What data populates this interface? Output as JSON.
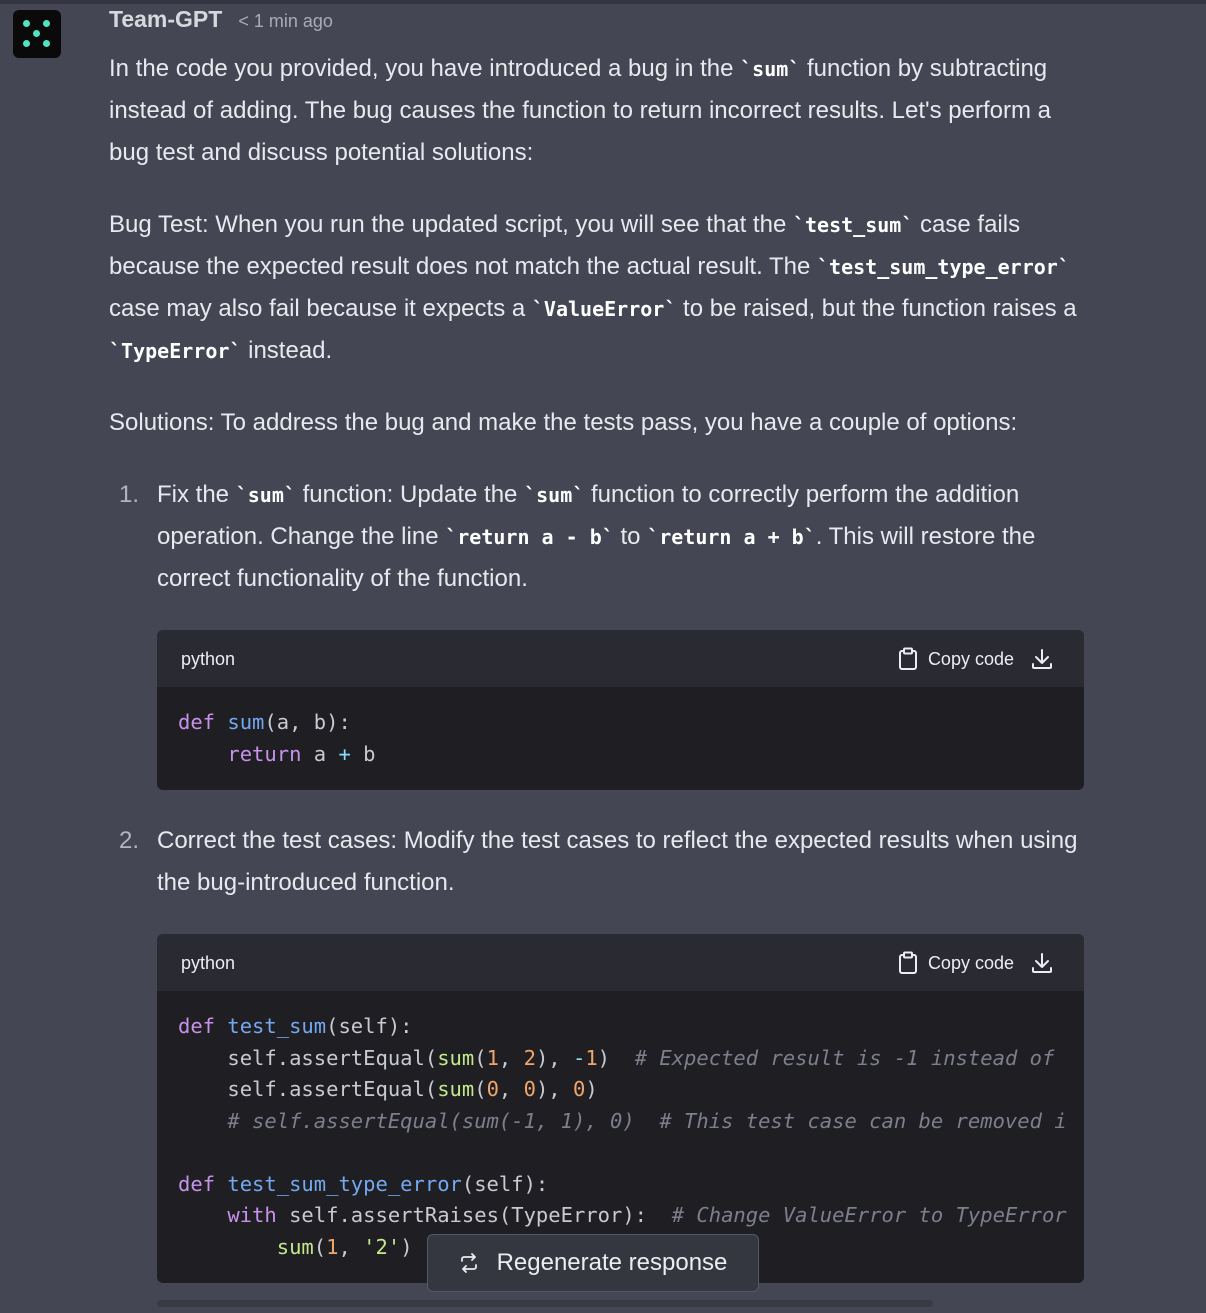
{
  "message": {
    "sender": "Team-GPT",
    "timestamp": "< 1 min ago",
    "para1": {
      "t1": "In the code you provided, you have introduced a bug in the ",
      "c1": "`sum`",
      "t2": " function by subtracting instead of adding. The bug causes the function to return incorrect results. Let's perform a bug test and discuss potential solutions:"
    },
    "para2": {
      "t1": "Bug Test: When you run the updated script, you will see that the ",
      "c1": "`test_sum`",
      "t2": " case fails because the expected result does not match the actual result. The ",
      "c2": "`test_sum_type_error`",
      "t3": " case may also fail because it expects a ",
      "c3": "`ValueError`",
      "t4": " to be raised, but the function raises a ",
      "c4": "`TypeError`",
      "t5": " instead."
    },
    "para3": "Solutions: To address the bug and make the tests pass, you have a couple of options:",
    "item1": {
      "number": "1.",
      "t1": "Fix the ",
      "c1": "`sum`",
      "t2": " function: Update the ",
      "c2": "`sum`",
      "t3": " function to correctly perform the addition operation. Change the line ",
      "c3": "`return a - b`",
      "t4": " to ",
      "c4": "`return a + b`",
      "t5": ". This will restore the correct functionality of the function."
    },
    "item2": {
      "number": "2.",
      "t1": "Correct the test cases: Modify the test cases to reflect the expected results when using the bug-introduced function."
    }
  },
  "codeblocks": [
    {
      "language": "python",
      "copy_label": "Copy code",
      "lines": [
        "def sum(a, b):",
        "    return a + b"
      ]
    },
    {
      "language": "python",
      "copy_label": "Copy code",
      "lines": [
        "def test_sum(self):",
        "    self.assertEqual(sum(1, 2), -1)  # Expected result is -1 instead of",
        "    self.assertEqual(sum(0, 0), 0)",
        "    # self.assertEqual(sum(-1, 1), 0)  # This test case can be removed i",
        "",
        "def test_sum_type_error(self):",
        "    with self.assertRaises(TypeError):  # Change ValueError to TypeError",
        "        sum(1, '2')"
      ]
    }
  ],
  "regenerate_label": "Regenerate response",
  "icons": {
    "avatar": "team-gpt-logo-icon",
    "copy": "clipboard-icon",
    "download": "download-icon",
    "regenerate": "refresh-icon"
  },
  "colors": {
    "background": "#444654",
    "code_bg": "#1f1f23",
    "accent": "#4ee6c2"
  }
}
